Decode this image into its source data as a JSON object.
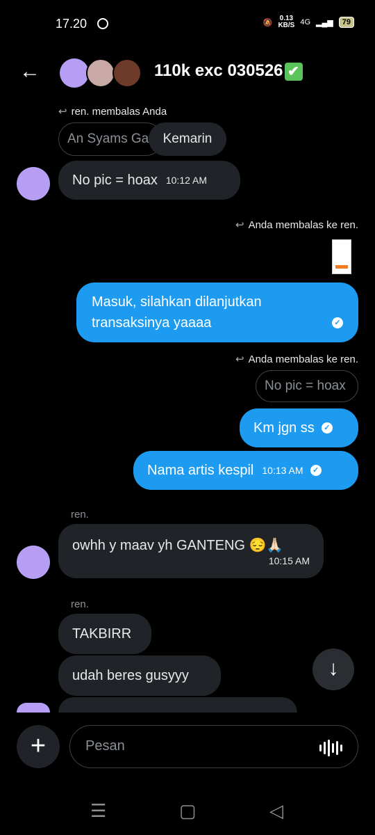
{
  "status_bar": {
    "time": "17.20",
    "speed_value": "0.13",
    "speed_unit": "KB/S",
    "network": "4G",
    "battery": "79"
  },
  "header": {
    "title": "110k exc 030526",
    "verified_emoji": "✔"
  },
  "messages": [
    {
      "reply_note": "ren. membalas Anda",
      "quote": "An Syams Ga",
      "date_chip": "Kemarin"
    },
    {
      "text": "No pic = hoax",
      "time": "10:12 AM"
    },
    {
      "reply_note": "Anda membalas ke ren."
    },
    {
      "text_line1": "Masuk, silahkan dilanjutkan",
      "text_line2": "transaksinya yaaaa"
    },
    {
      "reply_note": "Anda membalas ke ren.",
      "quote": "No pic = hoax"
    },
    {
      "text": "Km jgn ss"
    },
    {
      "text": "Nama artis kespil",
      "time": "10:13 AM"
    },
    {
      "sender": "ren.",
      "text": "owhh y maav yh GANTENG 😔🙏🏻",
      "time": "10:15 AM"
    },
    {
      "sender": "ren.",
      "text": "TAKBIRR"
    },
    {
      "text": "udah beres gusyyy"
    }
  ],
  "composer": {
    "placeholder": "Pesan"
  },
  "icons": {
    "back": "arrow-left-icon",
    "scroll_down": "arrow-down-icon",
    "add": "plus-icon",
    "voice": "waveform-icon"
  }
}
